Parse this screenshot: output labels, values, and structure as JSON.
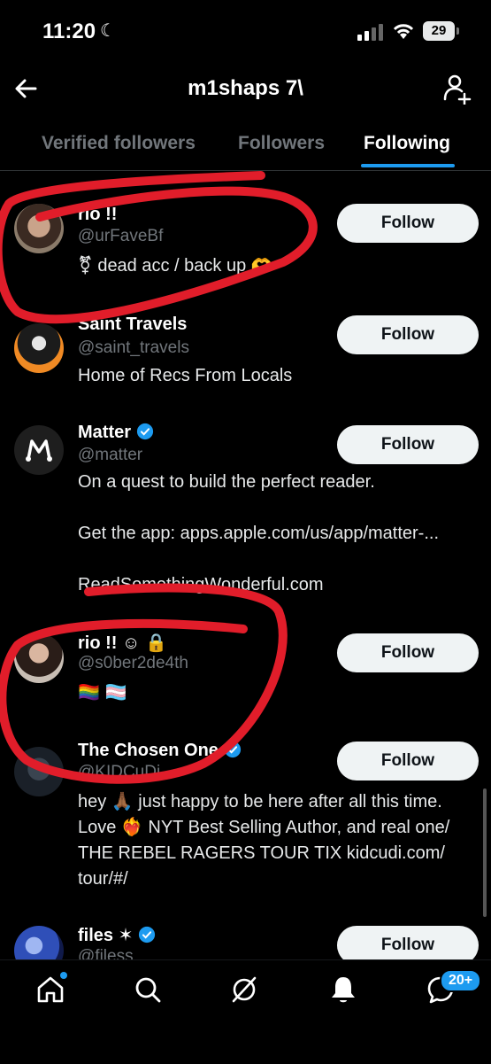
{
  "status_bar": {
    "time": "11:20",
    "battery": "29"
  },
  "header": {
    "title": "m1shaps 7\\"
  },
  "tabs": [
    {
      "label": "Verified followers",
      "active": false
    },
    {
      "label": "Followers",
      "active": false
    },
    {
      "label": "Following",
      "active": true
    }
  ],
  "accounts": [
    {
      "name": "rio !!",
      "handle": "@urFaveBf",
      "bio": "⚧ dead acc / back up 🫶",
      "verified": false,
      "follow_label": "Follow"
    },
    {
      "name": "Saint Travels",
      "handle": "@saint_travels",
      "bio": "Home of Recs From Locals",
      "verified": false,
      "follow_label": "Follow"
    },
    {
      "name": "Matter",
      "handle": "@matter",
      "bio": "On a quest to build the perfect reader.\n\nGet the app: apps.apple.com/us/app/matter-...\n\nReadSomethingWonderful.com",
      "verified": true,
      "follow_label": "Follow"
    },
    {
      "name": "rio !! ☺ 🔒",
      "handle": "@s0ber2de4th",
      "bio": "🏳️‍🌈 🏳️‍⚧️",
      "verified": false,
      "follow_label": "Follow"
    },
    {
      "name": "The Chosen One",
      "handle": "@KIDCuDi",
      "bio": "hey 🙏🏾 just happy to be here after all this time. Love ❤️‍🔥 NYT Best Selling Author, and real one/ THE REBEL RAGERS TOUR TIX kidcudi.com/ tour/#/",
      "verified": true,
      "follow_label": "Follow"
    },
    {
      "name": "files ✶",
      "handle": "@filess",
      "bio": "",
      "verified": true,
      "follow_label": "Follow"
    }
  ],
  "bottom_nav": {
    "items": [
      "home-icon",
      "search-icon",
      "grok-icon",
      "notifications-icon",
      "messages-icon"
    ],
    "messages_badge": "20+"
  },
  "colors": {
    "accent": "#1d9bf0",
    "annotation": "#e11d2a",
    "background": "#000000"
  }
}
